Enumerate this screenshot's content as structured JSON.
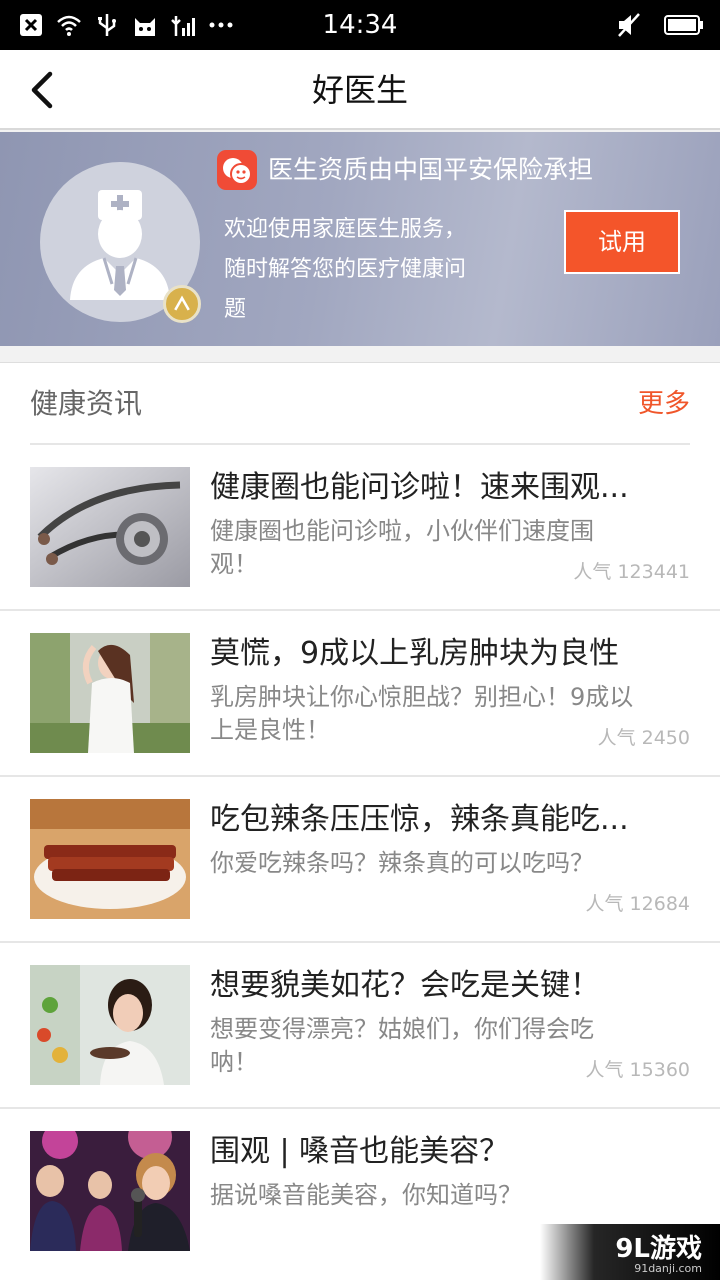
{
  "status_bar": {
    "time": "14:34",
    "left_icons": [
      "close-notification-icon",
      "wifi-icon",
      "usb-icon",
      "cat-icon",
      "signal-icon",
      "more-dots-icon"
    ],
    "right_icons": [
      "mute-icon",
      "battery-icon"
    ]
  },
  "header": {
    "title": "好医生"
  },
  "banner": {
    "insurance_text": "医生资质由中国平安保险承担",
    "welcome_text": "欢迎使用家庭医生服务，随时解答您的医疗健康问题",
    "try_button": "试用",
    "colors": {
      "accent": "#f4552a",
      "banner_bg": "#9aa0bb"
    }
  },
  "news": {
    "section_title": "健康资讯",
    "more_label": "更多",
    "items": [
      {
        "title": "健康圈也能问诊啦！速来围观...",
        "desc": "健康圈也能问诊啦，小伙伴们速度围观！",
        "popularity": "人气 123441",
        "thumb": "stethoscope-image"
      },
      {
        "title": "莫慌，9成以上乳房肿块为良性",
        "desc": "乳房肿块让你心惊胆战？别担心！9成以上是良性！",
        "popularity": "人气 2450",
        "thumb": "woman-garden-image"
      },
      {
        "title": "吃包辣条压压惊，辣条真能吃...",
        "desc": "你爱吃辣条吗？辣条真的可以吃吗？",
        "popularity": "人气 12684",
        "thumb": "spicy-strips-image"
      },
      {
        "title": "想要貌美如花？会吃是关键！",
        "desc": "想要变得漂亮？姑娘们，你们得会吃呐！",
        "popularity": "人气 15360",
        "thumb": "woman-eating-image"
      },
      {
        "title": "围观 | 嗓音也能美容？",
        "desc": "据说嗓音能美容，你知道吗？",
        "popularity": "",
        "thumb": "singers-image"
      }
    ]
  },
  "watermark": {
    "main": "9L游戏",
    "sub": "91danji.com"
  }
}
